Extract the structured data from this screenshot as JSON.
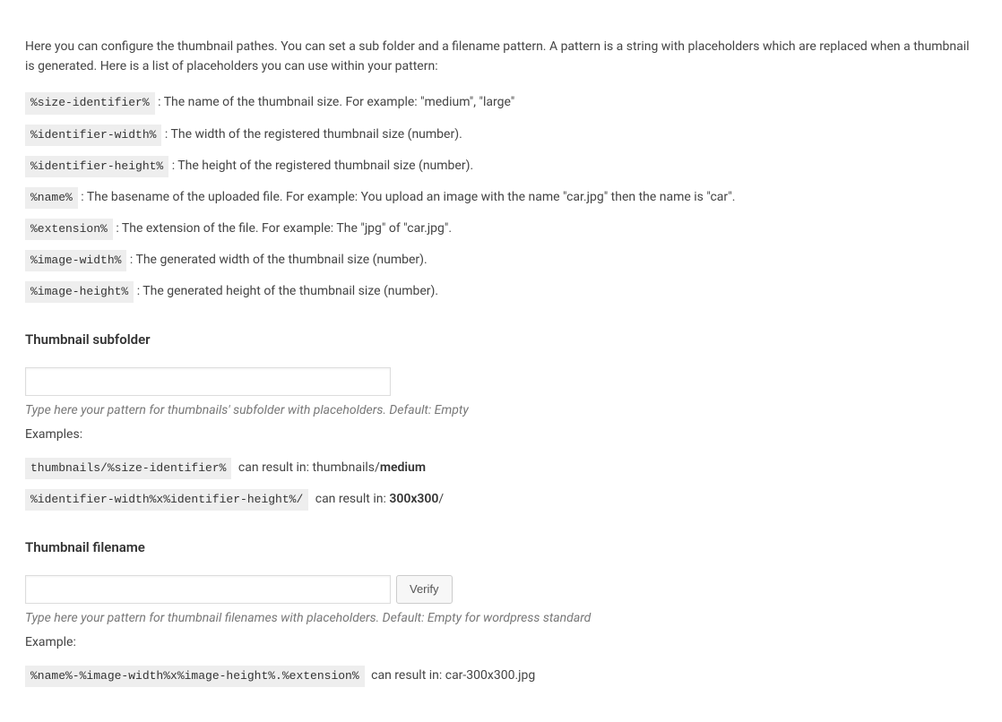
{
  "intro": "Here you can configure the thumbnail pathes. You can set a sub folder and a filename pattern. A pattern is a string with placeholders which are replaced when a thumbnail is generated. Here is a list of placeholders you can use within your pattern:",
  "placeholders": [
    {
      "token": "%size-identifier%",
      "desc": ": The name of the thumbnail size. For example: \"medium\", \"large\""
    },
    {
      "token": "%identifier-width%",
      "desc": ": The width of the registered thumbnail size (number)."
    },
    {
      "token": "%identifier-height%",
      "desc": ": The height of the registered thumbnail size (number)."
    },
    {
      "token": "%name%",
      "desc": ": The basename of the uploaded file. For example: You upload an image with the name \"car.jpg\" then the name is \"car\"."
    },
    {
      "token": "%extension%",
      "desc": ": The extension of the file. For example: The \"jpg\" of \"car.jpg\"."
    },
    {
      "token": "%image-width%",
      "desc": ": The generated width of the thumbnail size (number)."
    },
    {
      "token": "%image-height%",
      "desc": ": The generated height of the thumbnail size (number)."
    }
  ],
  "subfolder": {
    "title": "Thumbnail subfolder",
    "value": "",
    "hint": "Type here your pattern for thumbnails' subfolder with placeholders. Default: Empty",
    "examplesLabel": "Examples:",
    "examples": [
      {
        "token": "thumbnails/%size-identifier%",
        "lead": " can result in: thumbnails/",
        "bold": "medium",
        "tail": ""
      },
      {
        "token": "%identifier-width%x%identifier-height%/",
        "lead": " can result in: ",
        "bold": "300x300",
        "tail": "/"
      }
    ]
  },
  "filename": {
    "title": "Thumbnail filename",
    "value": "",
    "verifyLabel": "Verify",
    "hint": "Type here your pattern for thumbnail filenames with placeholders. Default: Empty for wordpress standard",
    "exampleLabel": "Example:",
    "example": {
      "token": "%name%-%image-width%x%image-height%.%extension%",
      "lead": " can result in: car-300x300.jpg"
    }
  }
}
